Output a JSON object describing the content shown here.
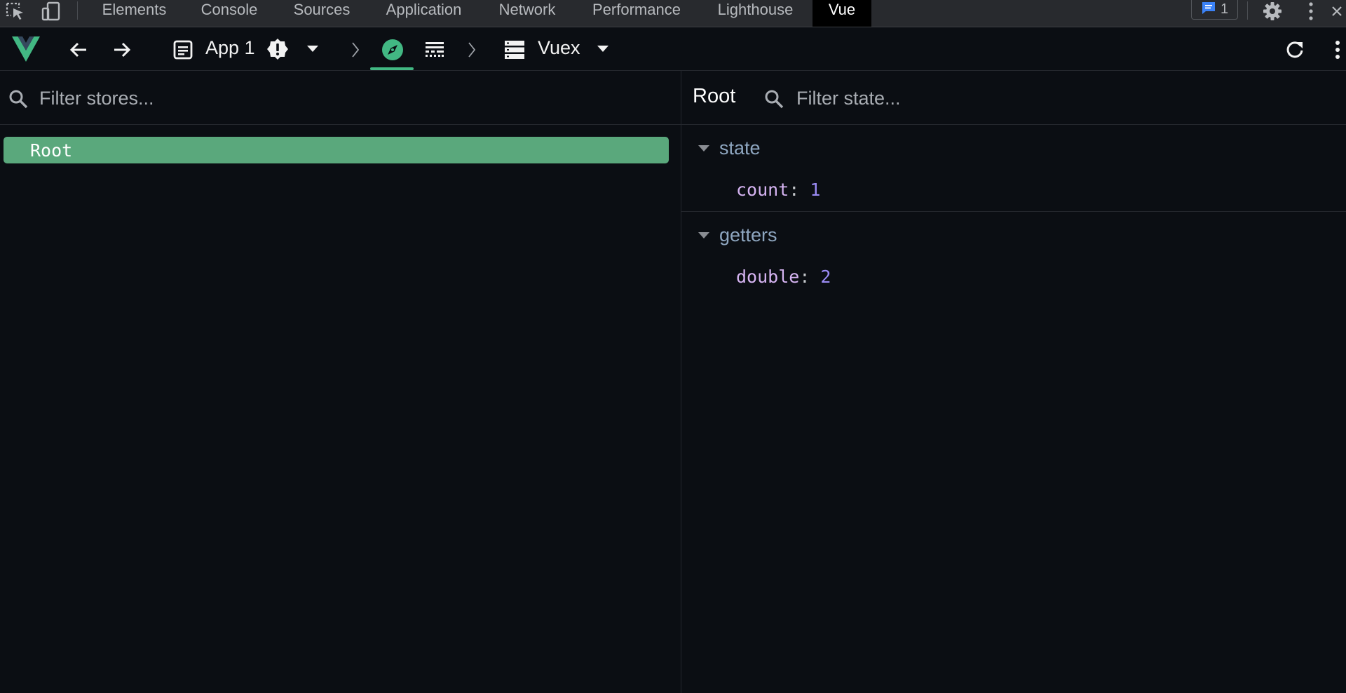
{
  "devtools": {
    "tabs": [
      {
        "label": "Elements",
        "active": false
      },
      {
        "label": "Console",
        "active": false
      },
      {
        "label": "Sources",
        "active": false
      },
      {
        "label": "Application",
        "active": false
      },
      {
        "label": "Network",
        "active": false
      },
      {
        "label": "Performance",
        "active": false
      },
      {
        "label": "Lighthouse",
        "active": false
      },
      {
        "label": "Vue",
        "active": true
      }
    ],
    "message_count": "1",
    "icons": [
      "inspect-element-icon",
      "device-toolbar-icon",
      "messages-icon",
      "settings-icon",
      "more-options-icon"
    ]
  },
  "toolbar": {
    "app_name": "App 1",
    "inspector_name": "Vuex",
    "accent_color": "#42b883",
    "icons": [
      "vue-logo-icon",
      "back-arrow-icon",
      "forward-arrow-icon",
      "app-icon",
      "warning-icon",
      "dropdown-icon",
      "breadcrumb-chevron-icon",
      "compass-icon",
      "timeline-icon",
      "breadcrumb-chevron-icon",
      "storage-icon",
      "dropdown-icon",
      "refresh-icon",
      "more-options-icon"
    ]
  },
  "stores": {
    "search_placeholder": "Filter stores...",
    "items": [
      {
        "label": "Root",
        "selected": true
      }
    ],
    "selected_color": "#5aa87c"
  },
  "state_panel": {
    "title": "Root",
    "search_placeholder": "Filter state...",
    "sections": [
      {
        "header": "state",
        "props": [
          {
            "key": "count",
            "value": "1"
          }
        ]
      },
      {
        "header": "getters",
        "props": [
          {
            "key": "double",
            "value": "2"
          }
        ]
      }
    ]
  }
}
